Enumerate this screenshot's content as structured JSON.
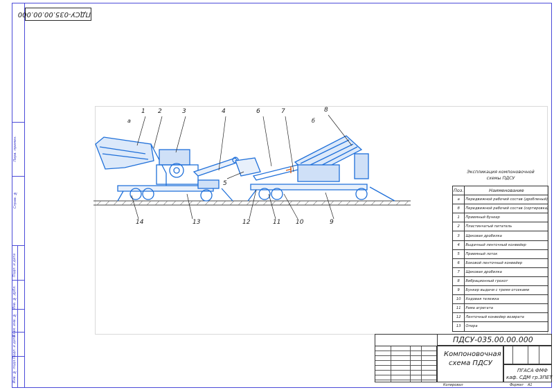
{
  "stamp_code": "ПДСУ-035.00.00.000",
  "title_block": {
    "designation": "ПДСУ-035.00.00.000",
    "title_line1": "Компоновочная",
    "title_line2": "схема ПДСУ",
    "org_line1": "ПГАСА ФМФ",
    "org_line2": "каф. СДМ гр.ЗПЕТ",
    "format_label": "Формат",
    "format_value": "А1",
    "copied_label": "Копировал"
  },
  "spec_table": {
    "title_line1": "Экспликация компоновочной",
    "title_line2": "схемы ПДСУ",
    "header_pos": "Поз.",
    "header_name": "Наименование",
    "rows": [
      {
        "pos": "а",
        "name": "Передвижной рабочий состав (дробленый)"
      },
      {
        "pos": "б",
        "name": "Передвижной рабочий состав (сортировка)"
      },
      {
        "pos": "1",
        "name": "Приемный бункер"
      },
      {
        "pos": "2",
        "name": "Пластинчатый питатель"
      },
      {
        "pos": "3",
        "name": "Щековая дробилка"
      },
      {
        "pos": "4",
        "name": "Выдачный ленточный конвейер"
      },
      {
        "pos": "5",
        "name": "Приемный лоток"
      },
      {
        "pos": "6",
        "name": "Боковой ленточный конвейер"
      },
      {
        "pos": "7",
        "name": "Щековая дробилка"
      },
      {
        "pos": "8",
        "name": "Вибрационный грохот"
      },
      {
        "pos": "9",
        "name": "Бункер выдачи с тремя отсеками"
      },
      {
        "pos": "10",
        "name": "Ходовая тележка"
      },
      {
        "pos": "11",
        "name": "Рама агрегата"
      },
      {
        "pos": "12",
        "name": "Ленточный конвейер возврата"
      },
      {
        "pos": "13",
        "name": "Опора"
      }
    ]
  },
  "callouts": [
    "1",
    "2",
    "3",
    "4",
    "5",
    "6",
    "7",
    "8",
    "9",
    "10",
    "11",
    "12",
    "13",
    "14"
  ],
  "unit_labels": [
    "а",
    "б"
  ],
  "left_strip_labels": [
    "Перв. примен.",
    "Справ. №",
    "Подп. и дата",
    "Инв. № дубл.",
    "Взам. инв. №",
    "Подп. и дата",
    "Инв. № подл."
  ],
  "colors": {
    "frame": "#4a4ad8",
    "machine": "#1e6fd9",
    "ground": "#444444",
    "accent": "#e06010"
  }
}
